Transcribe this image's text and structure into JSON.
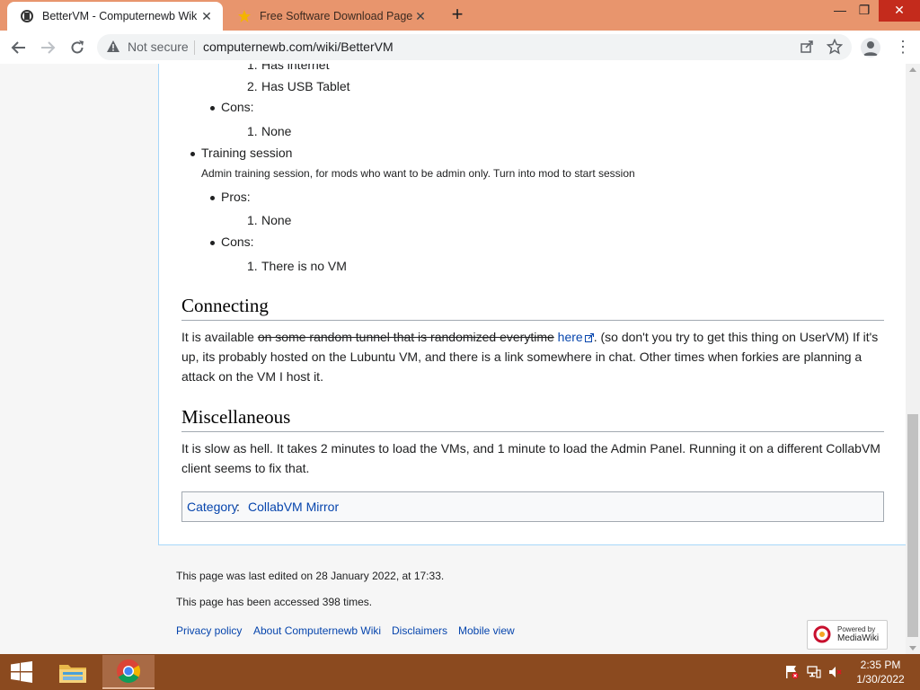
{
  "browser": {
    "tabs": [
      {
        "title": "BetterVM - Computernewb Wiki",
        "favicon": "wiki-logo-icon",
        "active": true
      },
      {
        "title": "Free Software Download Page - S",
        "favicon": "star-icon",
        "active": false
      }
    ],
    "new_tab": "+",
    "window_controls": {
      "minimize": "—",
      "maximize": "❐",
      "close": "✕"
    },
    "omnibox": {
      "security_label": "Not secure",
      "url": "computernewb.com/wiki/BetterVM"
    }
  },
  "page": {
    "list_top": {
      "item1": "Has internet",
      "item2": "Has USB Tablet",
      "cons_label": "Cons:",
      "cons_item1": "None"
    },
    "training": {
      "title": "Training session",
      "description": "Admin training session, for mods who want to be admin only. Turn into mod to start session",
      "pros_label": "Pros:",
      "pros_item1": "None",
      "cons_label": "Cons:",
      "cons_item1": "There is no VM"
    },
    "numbers": {
      "n1": "1.",
      "n2": "2."
    },
    "connecting": {
      "heading": "Connecting",
      "text_before": "It is available ",
      "strike_text": "on some random tunnel that is randomized everytime",
      "link_text": "here",
      "text_after": ". (so don't you try to get this thing on UserVM) If it's up, its probably hosted on the Lubuntu VM, and there is a link somewhere in chat. Other times when forkies are planning a attack on the VM I host it."
    },
    "misc": {
      "heading": "Miscellaneous",
      "text": "It is slow as hell. It takes 2 minutes to load the VMs, and 1 minute to load the Admin Panel. Running it on a different CollabVM client seems to fix that."
    },
    "category": {
      "label": "Category",
      "colon": ":",
      "link": "CollabVM Mirror"
    }
  },
  "footer": {
    "last_edited": "This page was last edited on 28 January 2022, at 17:33.",
    "accessed": "This page has been accessed 398 times.",
    "links": [
      "Privacy policy",
      "About Computernewb Wiki",
      "Disclaimers",
      "Mobile view"
    ],
    "powered_small": "Powered by",
    "powered_big": "MediaWiki"
  },
  "taskbar": {
    "apps": [
      "file-explorer-icon",
      "chrome-icon"
    ],
    "clock_time": "2:35 PM",
    "clock_date": "1/30/2022"
  },
  "colors": {
    "tabstrip": "#e8956d",
    "taskbar": "#8b4a1f",
    "link": "#0645ad"
  }
}
